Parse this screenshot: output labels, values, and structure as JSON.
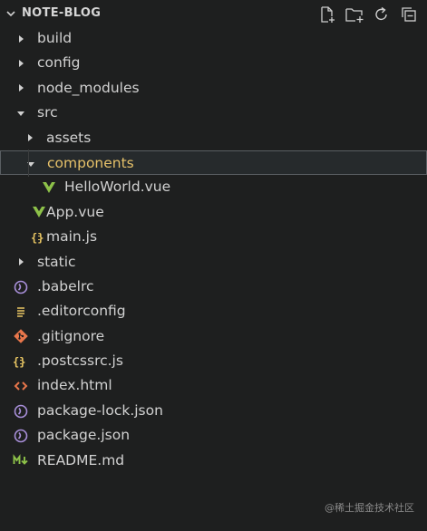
{
  "explorer": {
    "title": "NOTE-BLOG",
    "actions": [
      {
        "name": "new-file-icon"
      },
      {
        "name": "new-folder-icon"
      },
      {
        "name": "refresh-icon"
      },
      {
        "name": "collapse-all-icon"
      }
    ]
  },
  "tree": [
    {
      "label": "build",
      "kind": "folder",
      "expanded": false,
      "depth": 0,
      "icon": "chevron-right-icon"
    },
    {
      "label": "config",
      "kind": "folder",
      "expanded": false,
      "depth": 0,
      "icon": "chevron-right-icon"
    },
    {
      "label": "node_modules",
      "kind": "folder",
      "expanded": false,
      "depth": 0,
      "icon": "chevron-right-icon"
    },
    {
      "label": "src",
      "kind": "folder",
      "expanded": true,
      "depth": 0,
      "icon": "chevron-down-icon"
    },
    {
      "label": "assets",
      "kind": "folder",
      "expanded": false,
      "depth": 1,
      "icon": "chevron-right-icon"
    },
    {
      "label": "components",
      "kind": "folder",
      "expanded": true,
      "depth": 1,
      "icon": "chevron-down-icon",
      "selected": true
    },
    {
      "label": "HelloWorld.vue",
      "kind": "file",
      "depth": 2,
      "icon": "vue-icon"
    },
    {
      "label": "App.vue",
      "kind": "file",
      "depth": 1,
      "icon": "vue-icon"
    },
    {
      "label": "main.js",
      "kind": "file",
      "depth": 1,
      "icon": "js-icon"
    },
    {
      "label": "static",
      "kind": "folder",
      "expanded": false,
      "depth": 0,
      "icon": "chevron-right-icon"
    },
    {
      "label": ".babelrc",
      "kind": "file",
      "depth": 0,
      "icon": "babel-icon"
    },
    {
      "label": ".editorconfig",
      "kind": "file",
      "depth": 0,
      "icon": "editorconfig-icon"
    },
    {
      "label": ".gitignore",
      "kind": "file",
      "depth": 0,
      "icon": "git-icon"
    },
    {
      "label": ".postcssrc.js",
      "kind": "file",
      "depth": 0,
      "icon": "js-icon"
    },
    {
      "label": "index.html",
      "kind": "file",
      "depth": 0,
      "icon": "html-icon"
    },
    {
      "label": "package-lock.json",
      "kind": "file",
      "depth": 0,
      "icon": "npm-icon"
    },
    {
      "label": "package.json",
      "kind": "file",
      "depth": 0,
      "icon": "npm-icon"
    },
    {
      "label": "README.md",
      "kind": "file",
      "depth": 0,
      "icon": "markdown-icon"
    }
  ],
  "colors": {
    "background": "#1e1f1f",
    "selected_label": "#e5c069",
    "vue": "#8dc149",
    "js": "#e9c663",
    "git": "#e8764b",
    "html": "#e8764b",
    "config": "#a88fd9",
    "markdown": "#8dc149"
  },
  "watermark": "@稀土掘金技术社区"
}
